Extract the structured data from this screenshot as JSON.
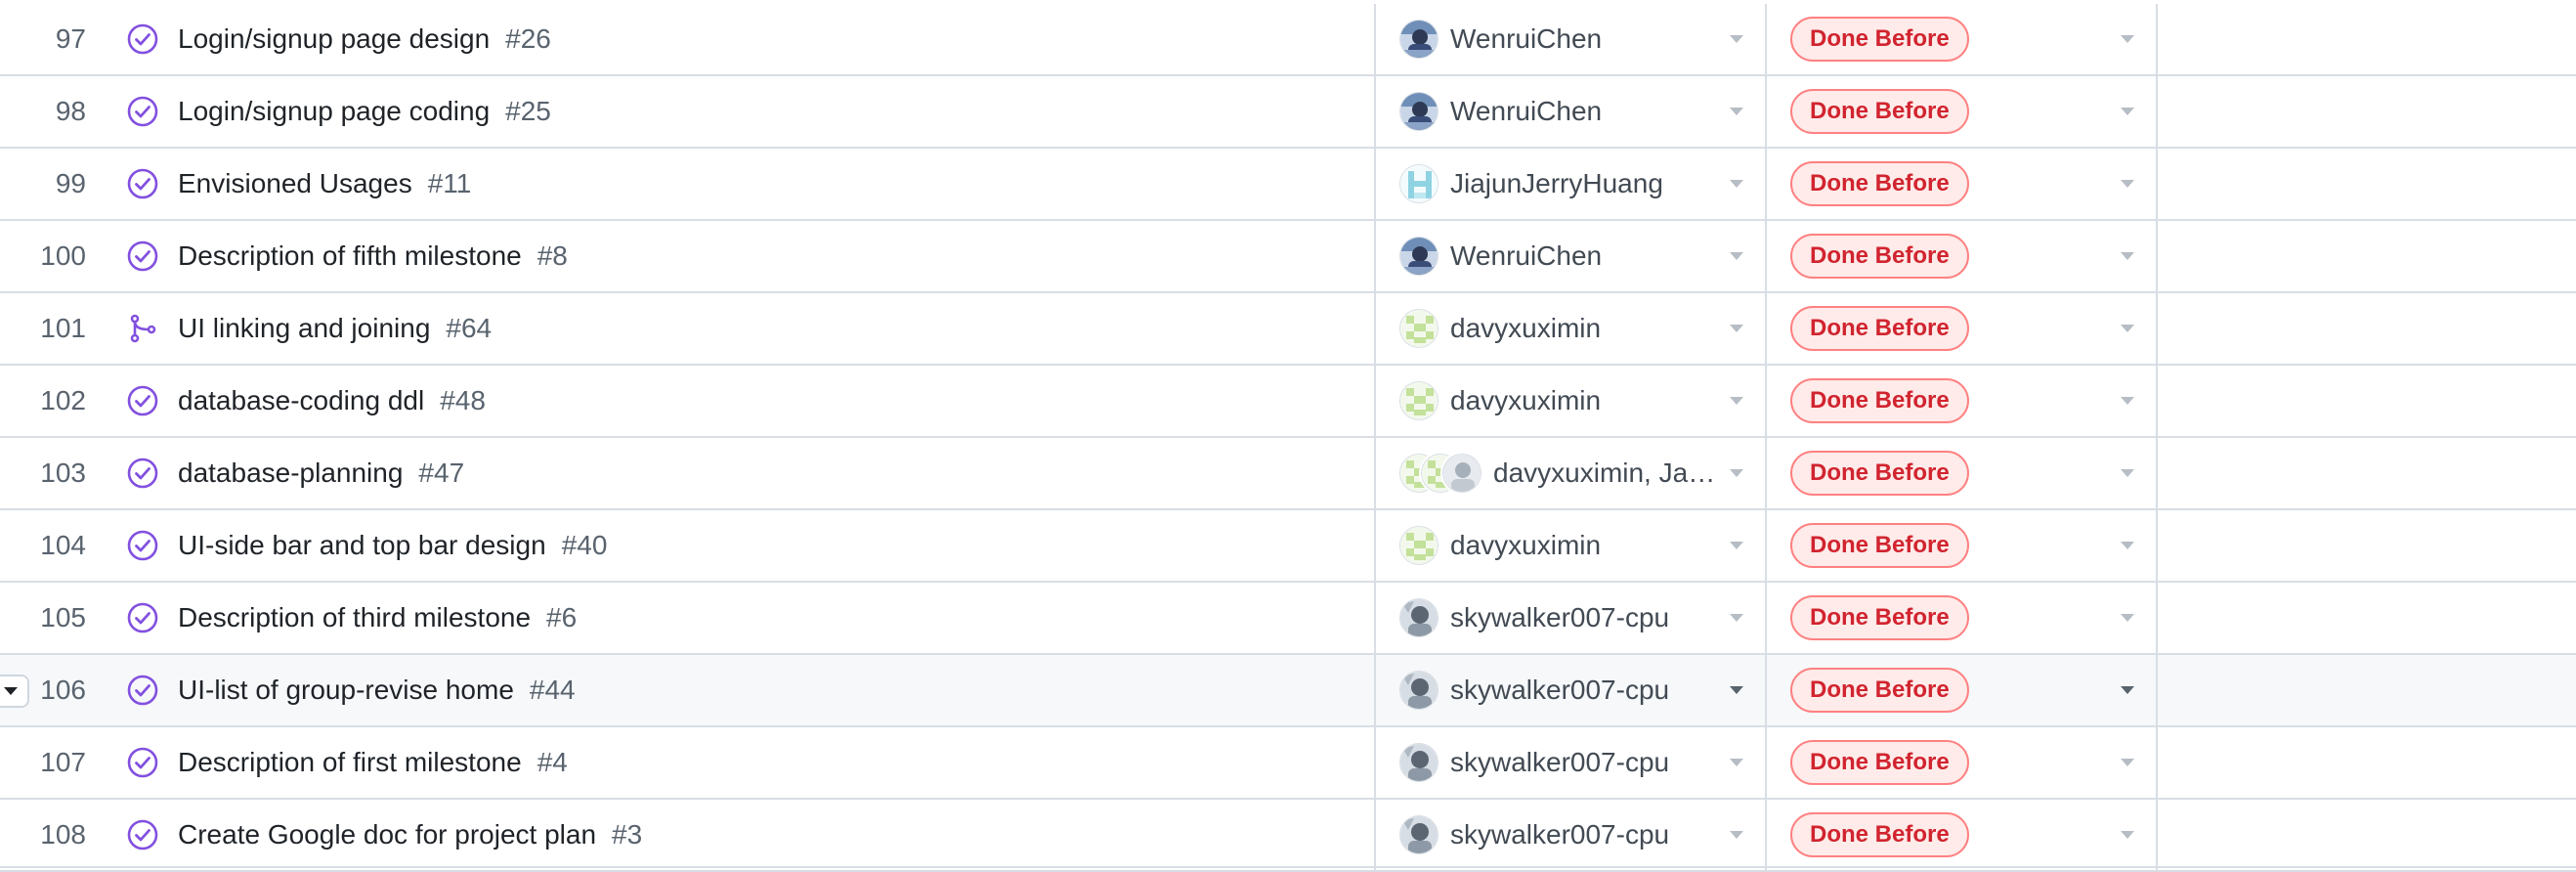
{
  "colors": {
    "done_icon": "#8250df",
    "badge_text": "#d1242f",
    "badge_bg": "#ffebe9",
    "badge_border": "#ff8182"
  },
  "rows": [
    {
      "number": "97",
      "type": "issue-closed",
      "type_icon": "check-circle-icon",
      "title": "Login/signup page design",
      "issue_ref": "#26",
      "assignee_avatar": "wenrui",
      "assignee_avatar_extra": [],
      "assignee": "WenruiChen",
      "status": "Done Before"
    },
    {
      "number": "98",
      "type": "issue-closed",
      "type_icon": "check-circle-icon",
      "title": "Login/signup page coding",
      "issue_ref": "#25",
      "assignee_avatar": "wenrui",
      "assignee_avatar_extra": [],
      "assignee": "WenruiChen",
      "status": "Done Before"
    },
    {
      "number": "99",
      "type": "issue-closed",
      "type_icon": "check-circle-icon",
      "title": "Envisioned Usages",
      "issue_ref": "#11",
      "assignee_avatar": "jiajun",
      "assignee_avatar_extra": [],
      "assignee": "JiajunJerryHuang",
      "status": "Done Before"
    },
    {
      "number": "100",
      "type": "issue-closed",
      "type_icon": "check-circle-icon",
      "title": "Description of fifth milestone",
      "issue_ref": "#8",
      "assignee_avatar": "wenrui",
      "assignee_avatar_extra": [],
      "assignee": "WenruiChen",
      "status": "Done Before"
    },
    {
      "number": "101",
      "type": "pull-request-merged",
      "type_icon": "git-merge-icon",
      "title": "UI linking and joining",
      "issue_ref": "#64",
      "assignee_avatar": "davy",
      "assignee_avatar_extra": [],
      "assignee": "davyxuximin",
      "status": "Done Before"
    },
    {
      "number": "102",
      "type": "issue-closed",
      "type_icon": "check-circle-icon",
      "title": "database-coding ddl",
      "issue_ref": "#48",
      "assignee_avatar": "davy",
      "assignee_avatar_extra": [],
      "assignee": "davyxuximin",
      "status": "Done Before"
    },
    {
      "number": "103",
      "type": "issue-closed",
      "type_icon": "check-circle-icon",
      "title": "database-planning",
      "issue_ref": "#47",
      "assignee_avatar": "davy",
      "assignee_avatar_extra": [
        "davy2",
        "gray"
      ],
      "assignee": "davyxuximin, Jas...",
      "status": "Done Before"
    },
    {
      "number": "104",
      "type": "issue-closed",
      "type_icon": "check-circle-icon",
      "title": "UI-side bar and top bar design",
      "issue_ref": "#40",
      "assignee_avatar": "davy",
      "assignee_avatar_extra": [],
      "assignee": "davyxuximin",
      "status": "Done Before"
    },
    {
      "number": "105",
      "type": "issue-closed",
      "type_icon": "check-circle-icon",
      "title": "Description of third milestone",
      "issue_ref": "#6",
      "assignee_avatar": "sky",
      "assignee_avatar_extra": [],
      "assignee": "skywalker007-cpu",
      "status": "Done Before"
    },
    {
      "number": "106",
      "type": "issue-closed",
      "type_icon": "check-circle-icon",
      "title": "UI-list of group-revise home",
      "issue_ref": "#44",
      "assignee_avatar": "sky",
      "assignee_avatar_extra": [],
      "assignee": "skywalker007-cpu",
      "status": "Done Before",
      "hovered": true
    },
    {
      "number": "107",
      "type": "issue-closed",
      "type_icon": "check-circle-icon",
      "title": "Description of first milestone",
      "issue_ref": "#4",
      "assignee_avatar": "sky",
      "assignee_avatar_extra": [],
      "assignee": "skywalker007-cpu",
      "status": "Done Before"
    },
    {
      "number": "108",
      "type": "issue-closed",
      "type_icon": "check-circle-icon",
      "title": "Create Google doc for project plan",
      "issue_ref": "#3",
      "assignee_avatar": "sky",
      "assignee_avatar_extra": [],
      "assignee": "skywalker007-cpu",
      "status": "Done Before"
    }
  ]
}
